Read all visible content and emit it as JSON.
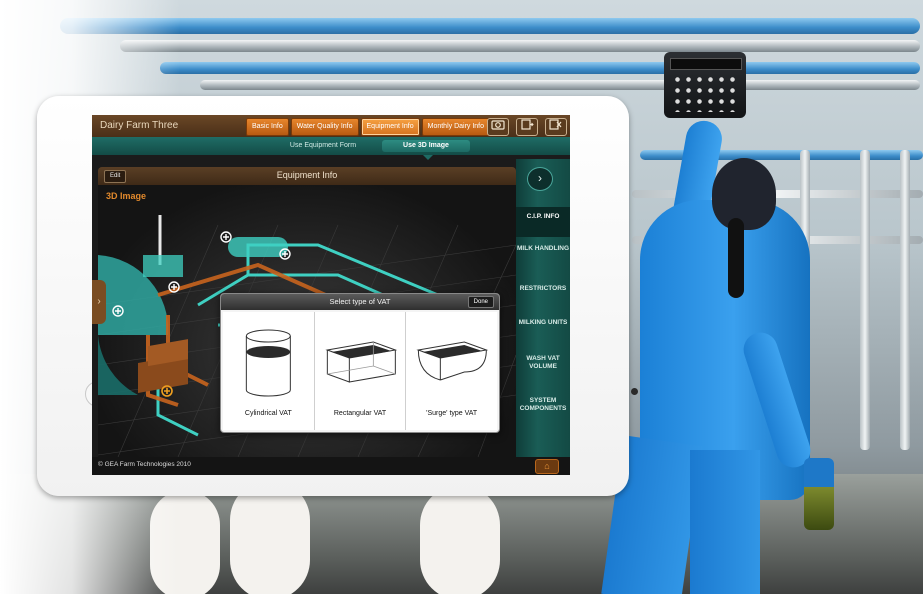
{
  "app": {
    "title": "Dairy Farm Three",
    "tabs": [
      {
        "label": "Basic Info",
        "active": false
      },
      {
        "label": "Water Quality Info",
        "active": false
      },
      {
        "label": "Equipment Info",
        "active": true
      },
      {
        "label": "Monthly Dairy Info",
        "active": false
      }
    ],
    "toolbar_icons": [
      "camera-icon",
      "export-icon",
      "close-icon"
    ]
  },
  "subtabs": [
    {
      "label": "Use Equipment Form",
      "active": false
    },
    {
      "label": "Use 3D Image",
      "active": true
    }
  ],
  "content": {
    "edit_label": "Edit",
    "title": "Equipment Info",
    "section_title": "3D Image"
  },
  "side_menu": [
    {
      "label": "C.I.P. INFO",
      "active": true
    },
    {
      "label": "MILK HANDLING",
      "active": false
    },
    {
      "label": "RESTRICTORS",
      "active": false
    },
    {
      "label": "MILKING UNITS",
      "active": false
    },
    {
      "label": "WASH VAT VOLUME",
      "active": false
    },
    {
      "label": "SYSTEM COMPONENTS",
      "active": false
    }
  ],
  "modal": {
    "title": "Select type of VAT",
    "done_label": "Done",
    "options": [
      {
        "label": "Cylindrical VAT"
      },
      {
        "label": "Rectangular VAT"
      },
      {
        "label": "'Surge' type VAT"
      }
    ]
  },
  "footer": {
    "copyright": "© GEA Farm Technologies 2010"
  },
  "colors": {
    "accent_orange": "#e7862c",
    "teal": "#1f6d66",
    "brown": "#5a3f25",
    "pipe_cyan": "#3fd0c2"
  }
}
